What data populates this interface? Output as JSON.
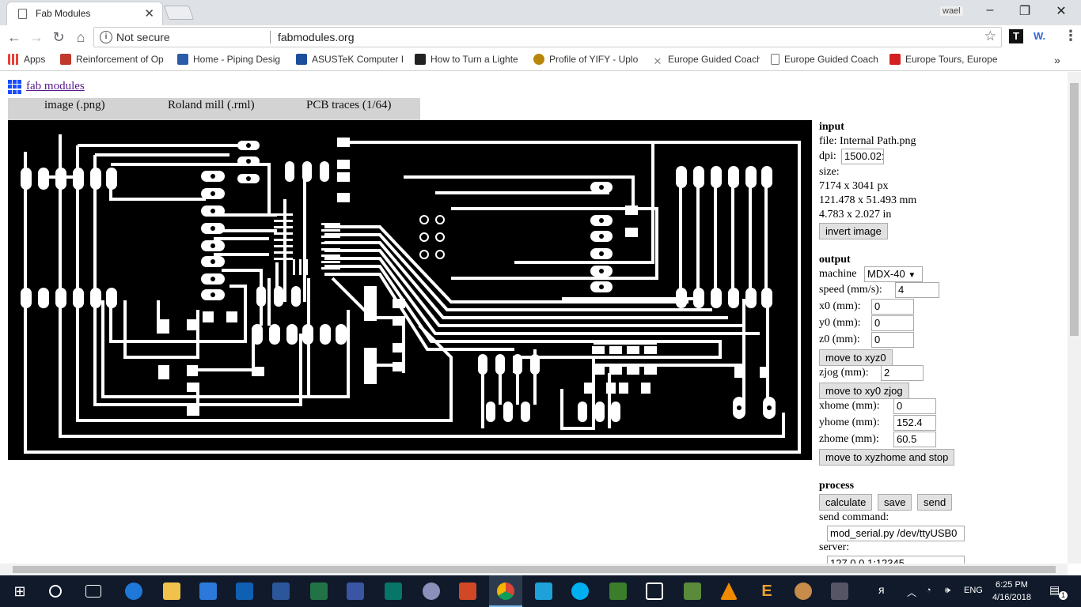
{
  "browser": {
    "tab_title": "Fab Modules",
    "profile_name": "wael",
    "security_label": "Not secure",
    "url": "fabmodules.org",
    "bookmarks": [
      {
        "label": "Apps",
        "color": "#e94235"
      },
      {
        "label": "Reinforcement of Op",
        "color": "#c0392b"
      },
      {
        "label": "Home - Piping Desig",
        "color": "#2a5caa"
      },
      {
        "label": "ASUSTeK Computer I",
        "color": "#1b4f9c"
      },
      {
        "label": "How to Turn a Lighte",
        "color": "#222222"
      },
      {
        "label": "Profile of YIFY - Uplo",
        "color": "#b8860b"
      },
      {
        "label": "Europe Guided Coach",
        "color": "#888888"
      },
      {
        "label": "Europe Guided Coach",
        "color": "#aaaaaa"
      },
      {
        "label": "Europe Tours, Europe",
        "color": "#d42020"
      }
    ]
  },
  "app": {
    "brand": "fab modules",
    "menu": [
      "image (.png)",
      "Roland mill (.rml)",
      "PCB traces (1/64)"
    ]
  },
  "input": {
    "heading": "input",
    "file_label": "file:",
    "file_name": "Internal Path.png",
    "dpi_label": "dpi:",
    "dpi_value": "1500.02:",
    "size_label": "size:",
    "size_px": "7174 x 3041 px",
    "size_mm": "121.478 x 51.493 mm",
    "size_in": "4.783 x 2.027 in",
    "invert_button": "invert image"
  },
  "output": {
    "heading": "output",
    "machine_label": "machine",
    "machine_value": "MDX-40",
    "speed_label": "speed (mm/s):",
    "speed_value": "4",
    "x0_label": "x0 (mm):",
    "x0_value": "0",
    "y0_label": "y0 (mm):",
    "y0_value": "0",
    "z0_label": "z0 (mm):",
    "z0_value": "0",
    "move_xyz0": "move to xyz0",
    "zjog_label": "zjog (mm):",
    "zjog_value": "2",
    "move_xy0_zjog": "move to xy0 zjog",
    "xhome_label": "xhome (mm):",
    "xhome_value": "0",
    "yhome_label": "yhome (mm):",
    "yhome_value": "152.4",
    "zhome_label": "zhome (mm):",
    "zhome_value": "60.5",
    "move_home": "move to xyzhome and stop"
  },
  "process": {
    "heading": "process",
    "calculate": "calculate",
    "save": "save",
    "send": "send",
    "send_command_label": "send command:",
    "send_command_value": "mod_serial.py /dev/ttyUSB0",
    "server_label": "server:",
    "server_value": "127.0.0.1:12345"
  },
  "taskbar": {
    "language": "ENG",
    "time": "6:25 PM",
    "date": "4/16/2018",
    "notification_count": "1"
  }
}
